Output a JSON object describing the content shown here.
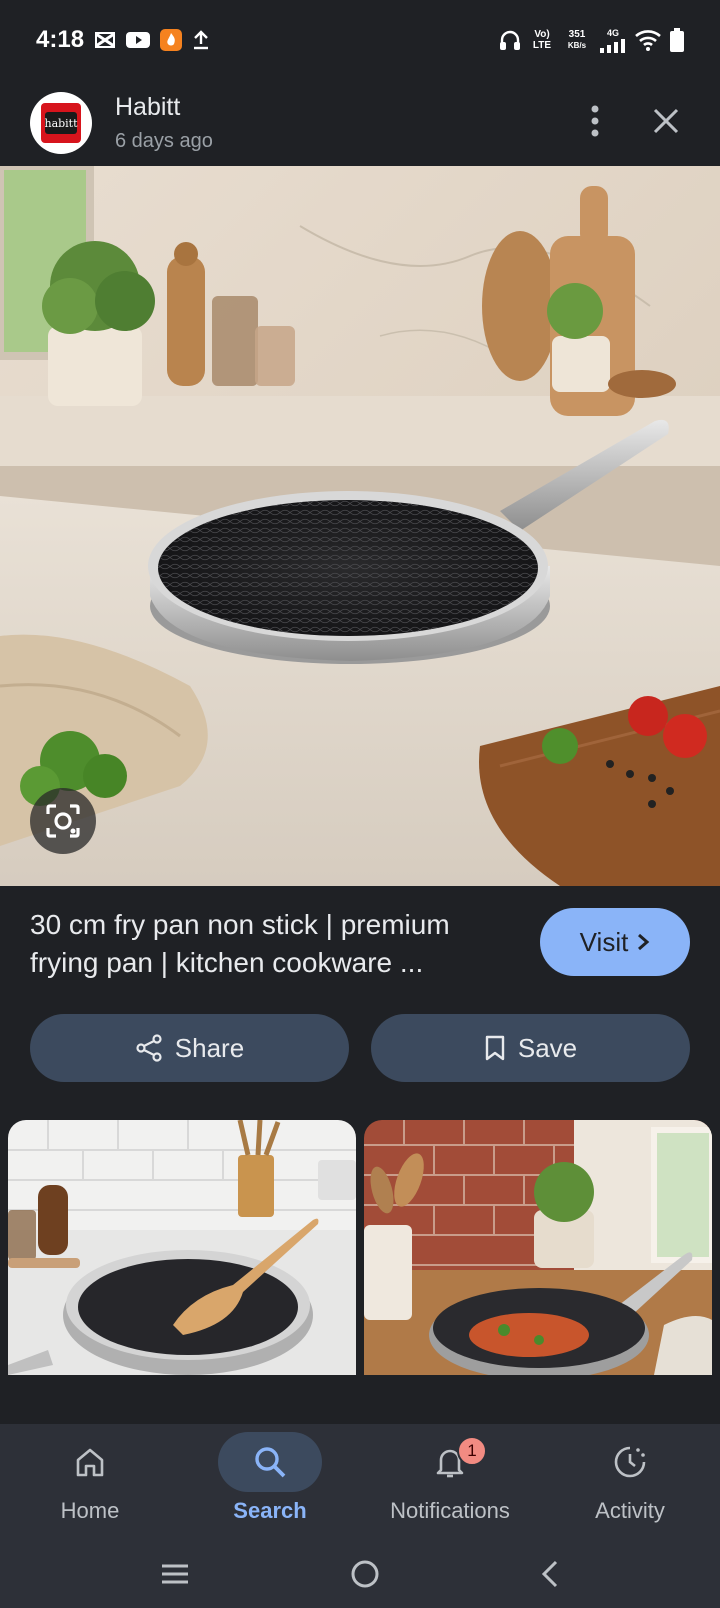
{
  "status_bar": {
    "time": "4:18",
    "volte": "Vo) LTE",
    "speed_value": "351",
    "speed_unit": "KB/s",
    "network": "4G"
  },
  "header": {
    "source_name": "Habitt",
    "posted": "6 days ago",
    "logo_text": "habitt"
  },
  "result": {
    "title": "30 cm fry pan non stick | premium frying pan | kitchen cookware ...",
    "visit_label": "Visit"
  },
  "actions": {
    "share_label": "Share",
    "save_label": "Save"
  },
  "bottom_nav": {
    "items": [
      {
        "label": "Home",
        "icon": "home-icon"
      },
      {
        "label": "Search",
        "icon": "search-icon",
        "active": true
      },
      {
        "label": "Notifications",
        "icon": "bell-icon",
        "badge": "1"
      },
      {
        "label": "Activity",
        "icon": "activity-icon"
      }
    ]
  },
  "colors": {
    "background": "#1f2125",
    "accent": "#8ab4f8",
    "button_bg": "#3c4a5e",
    "nav_bg": "#2d3038",
    "badge": "#f28b82"
  }
}
